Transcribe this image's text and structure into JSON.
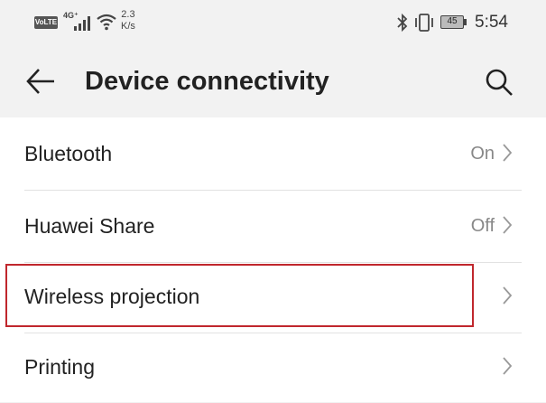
{
  "status_bar": {
    "volte": "VoLTE",
    "network": "4G⁺",
    "speed_value": "2.3",
    "speed_unit": "K/s",
    "battery": "45",
    "time": "5:54"
  },
  "header": {
    "title": "Device connectivity"
  },
  "settings": {
    "items": [
      {
        "label": "Bluetooth",
        "value": "On"
      },
      {
        "label": "Huawei Share",
        "value": "Off"
      },
      {
        "label": "Wireless projection",
        "value": ""
      },
      {
        "label": "Printing",
        "value": ""
      }
    ]
  },
  "annotation": {
    "highlighted_item": "Wireless projection",
    "color": "#c0272d"
  }
}
